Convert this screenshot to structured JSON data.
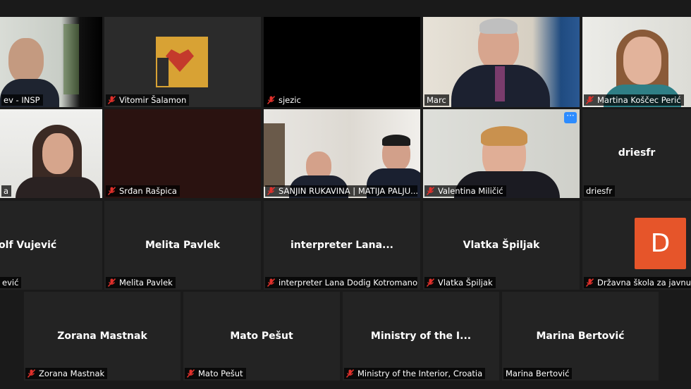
{
  "participants": {
    "r1": [
      {
        "name": "ev - INSP",
        "muted": false
      },
      {
        "name": "Vitomir Šalamon",
        "muted": true
      },
      {
        "name": "sjezic",
        "muted": true
      },
      {
        "name": "Marc",
        "muted": false
      },
      {
        "name": "Martina Koščec Perić",
        "muted": true
      }
    ],
    "r2": [
      {
        "name": "a",
        "muted": false
      },
      {
        "name": "Srđan Rašpica",
        "muted": true
      },
      {
        "name": "SANJIN RUKAVINA | MATIJA PALJU...",
        "muted": true
      },
      {
        "name": "Valentina Miličić",
        "muted": true
      },
      {
        "name": "driesfr",
        "muted": false,
        "display": "driesfr"
      }
    ],
    "r3": [
      {
        "name": "ević",
        "muted": false,
        "display": "dolf Vujević"
      },
      {
        "name": "Melita Pavlek",
        "muted": true,
        "display": "Melita Pavlek"
      },
      {
        "name": "interpreter Lana Dodig Kotromano...",
        "muted": true,
        "display": "interpreter  Lana..."
      },
      {
        "name": "Vlatka Špiljak",
        "muted": true,
        "display": "Vlatka Špiljak"
      },
      {
        "name": "Državna škola za javnu up",
        "muted": true,
        "avatar_letter": "D"
      }
    ],
    "r4": [
      {
        "name": "Zorana Mastnak",
        "muted": true,
        "display": "Zorana Mastnak"
      },
      {
        "name": "Mato Pešut",
        "muted": true,
        "display": "Mato Pešut"
      },
      {
        "name": "Ministry of the Interior, Croatia",
        "muted": true,
        "display": "Ministry of the I..."
      },
      {
        "name": "Marina Bertović",
        "muted": false,
        "display": "Marina Bertović"
      }
    ]
  },
  "icons": {
    "muted": "mic-muted-icon",
    "more": "more-options-icon"
  },
  "colors": {
    "active_speaker": "#d7e36f",
    "muted_red": "#e0302b",
    "avatar": "#e6552a",
    "more_btn": "#2d8cff"
  }
}
